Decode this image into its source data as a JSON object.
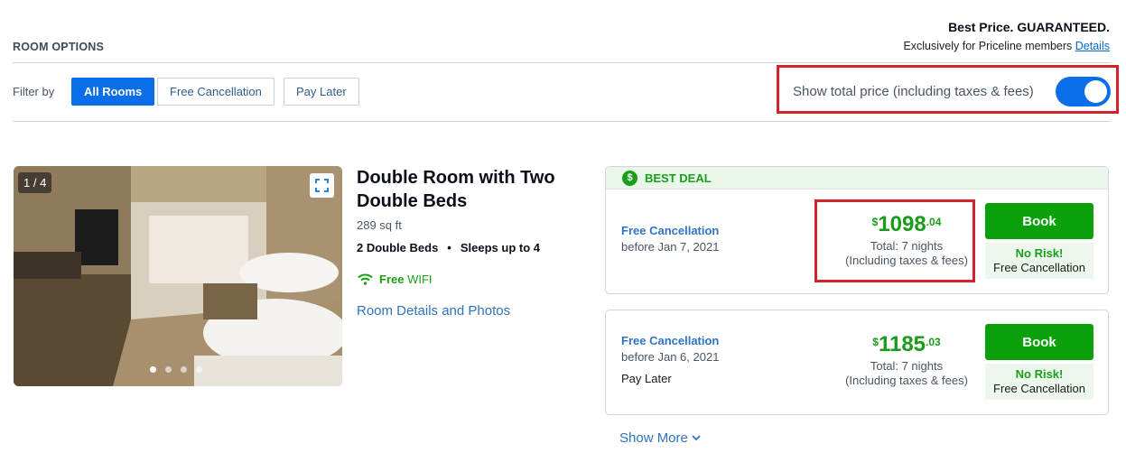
{
  "header": {
    "section_title": "ROOM OPTIONS",
    "guarantee_title": "Best Price. GUARANTEED.",
    "guarantee_sub": "Exclusively for Priceline members",
    "details_link": "Details"
  },
  "filters": {
    "label": "Filter by",
    "options": [
      "All Rooms",
      "Free Cancellation",
      "Pay Later"
    ],
    "active": "All Rooms"
  },
  "total_price_toggle": {
    "label": "Show total price (including taxes & fees)",
    "on": true
  },
  "room": {
    "photo_counter": "1 / 4",
    "photo_count": 4,
    "photo_index": 1,
    "title_line1": "Double Room with Two",
    "title_line2": "Double Beds",
    "size": "289 sq ft",
    "beds": "2 Double Beds",
    "bullet": "•",
    "sleeps": "Sleeps up to 4",
    "wifi_free": "Free",
    "wifi_label": "WIFI",
    "details_link": "Room Details and Photos"
  },
  "rates": [
    {
      "badge": "BEST DEAL",
      "cancel_title": "Free Cancellation",
      "cancel_date": "before Jan 7, 2021",
      "pay_later": "",
      "currency": "$",
      "amount": "1098",
      "cents": ".04",
      "nights": "Total: 7 nights",
      "taxes": "(Including taxes & fees)",
      "book_label": "Book",
      "norisk_title": "No Risk!",
      "norisk_sub": "Free Cancellation"
    },
    {
      "badge": "",
      "cancel_title": "Free Cancellation",
      "cancel_date": "before Jan 6, 2021",
      "pay_later": "Pay Later",
      "currency": "$",
      "amount": "1185",
      "cents": ".03",
      "nights": "Total: 7 nights",
      "taxes": "(Including taxes & fees)",
      "book_label": "Book",
      "norisk_title": "No Risk!",
      "norisk_sub": "Free Cancellation"
    }
  ],
  "show_more": "Show More",
  "colors": {
    "brand_blue": "#0a6ee8",
    "price_green": "#1a9b1a",
    "book_green": "#0aa10a",
    "highlight_red": "#d2232a"
  }
}
